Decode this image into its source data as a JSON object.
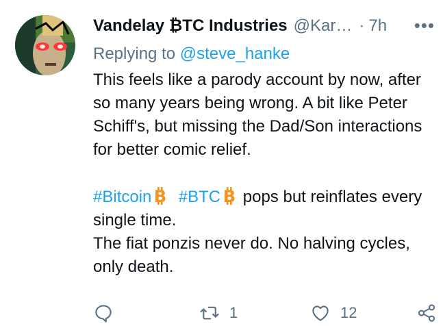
{
  "tweet": {
    "display_name": "Vandelay ₿TC Industries",
    "handle": "@Kar…",
    "separator": "·",
    "time": "7h",
    "more": "•••",
    "replying_prefix": "Replying to ",
    "replying_to": "@steve_hanke",
    "paragraph1": "This feels like a parody account by now, after so many years being wrong. A bit like Peter Schiff's, but missing the Dad/Son interactions for better comic relief.",
    "hashtag1": "#Bitcoin",
    "hashtag2": "#BTC",
    "paragraph2_rest": " pops but reinflates every single time.",
    "paragraph3": "The fiat ponzis never do. No halving cycles, only death."
  },
  "actions": {
    "reply_count": "",
    "retweet_count": "1",
    "like_count": "12"
  },
  "colors": {
    "accent": "#1da1f2",
    "secondary_text": "#5b7083",
    "bitcoin_orange": "#f7931a"
  },
  "icons": {
    "reply": "reply-icon",
    "retweet": "retweet-icon",
    "like": "heart-icon",
    "share": "share-icon",
    "bitcoin": "bitcoin-emoji-icon"
  }
}
